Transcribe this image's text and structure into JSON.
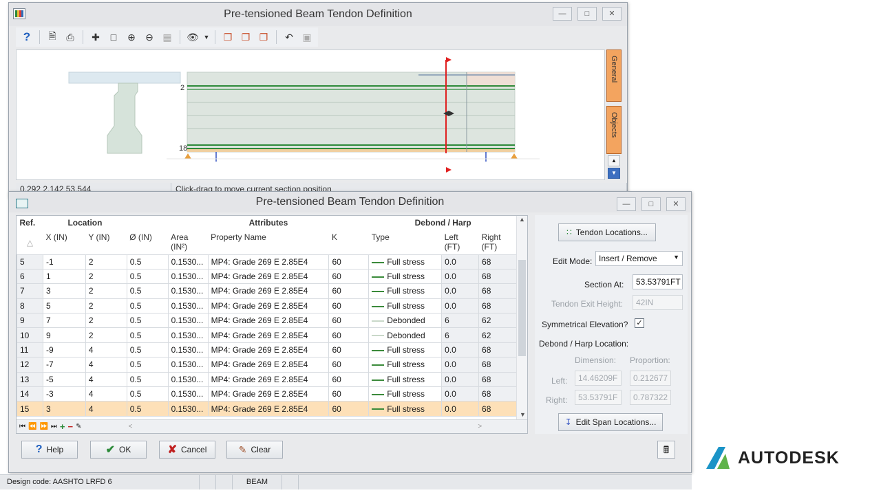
{
  "top_window": {
    "title": "Pre-tensioned Beam Tendon Definition",
    "canvas": {
      "top_label": "2",
      "bottom_label": "18"
    },
    "side_tabs": [
      "General",
      "Objects"
    ],
    "status": {
      "coords": "0.292  2.142  53.544",
      "hint": "Click-drag to move current section position"
    }
  },
  "dialog": {
    "title": "Pre-tensioned Beam Tendon Definition",
    "group_headers": {
      "ref": "Ref.",
      "location": "Location",
      "attributes": "Attributes",
      "debond": "Debond / Harp"
    },
    "columns": [
      "",
      "X (IN)",
      "Y (IN)",
      "Ø (IN)",
      "Area (IN²)",
      "Property Name",
      "K",
      "Type",
      "Left (FT)",
      "Right (FT)"
    ],
    "rows": [
      [
        "5",
        "-1",
        "2",
        "0.5",
        "0.1530...",
        "MP4: Grade 269 E 2.85E4",
        "60",
        "Full stress",
        "0.0",
        "68"
      ],
      [
        "6",
        "1",
        "2",
        "0.5",
        "0.1530...",
        "MP4: Grade 269 E 2.85E4",
        "60",
        "Full stress",
        "0.0",
        "68"
      ],
      [
        "7",
        "3",
        "2",
        "0.5",
        "0.1530...",
        "MP4: Grade 269 E 2.85E4",
        "60",
        "Full stress",
        "0.0",
        "68"
      ],
      [
        "8",
        "5",
        "2",
        "0.5",
        "0.1530...",
        "MP4: Grade 269 E 2.85E4",
        "60",
        "Full stress",
        "0.0",
        "68"
      ],
      [
        "9",
        "7",
        "2",
        "0.5",
        "0.1530...",
        "MP4: Grade 269 E 2.85E4",
        "60",
        "Debonded",
        "6",
        "62"
      ],
      [
        "10",
        "9",
        "2",
        "0.5",
        "0.1530...",
        "MP4: Grade 269 E 2.85E4",
        "60",
        "Debonded",
        "6",
        "62"
      ],
      [
        "11",
        "-9",
        "4",
        "0.5",
        "0.1530...",
        "MP4: Grade 269 E 2.85E4",
        "60",
        "Full stress",
        "0.0",
        "68"
      ],
      [
        "12",
        "-7",
        "4",
        "0.5",
        "0.1530...",
        "MP4: Grade 269 E 2.85E4",
        "60",
        "Full stress",
        "0.0",
        "68"
      ],
      [
        "13",
        "-5",
        "4",
        "0.5",
        "0.1530...",
        "MP4: Grade 269 E 2.85E4",
        "60",
        "Full stress",
        "0.0",
        "68"
      ],
      [
        "14",
        "-3",
        "4",
        "0.5",
        "0.1530...",
        "MP4: Grade 269 E 2.85E4",
        "60",
        "Full stress",
        "0.0",
        "68"
      ],
      [
        "15",
        "3",
        "4",
        "0.5",
        "0.1530...",
        "MP4: Grade 269 E 2.85E4",
        "60",
        "Full stress",
        "0.0",
        "68"
      ]
    ],
    "selected_row": "15",
    "right_panel": {
      "tendon_locations_btn": "Tendon Locations...",
      "edit_mode_label": "Edit Mode:",
      "edit_mode_value": "Insert / Remove",
      "section_at_label": "Section At:",
      "section_at_value": "53.53791FT",
      "tendon_exit_label": "Tendon Exit Height:",
      "tendon_exit_value": "42IN",
      "sym_elev_label": "Symmetrical Elevation?",
      "sym_elev_checked": true,
      "debond_group": "Debond / Harp Location:",
      "dimension_hdr": "Dimension:",
      "proportion_hdr": "Proportion:",
      "left_label": "Left:",
      "right_label": "Right:",
      "left_dim": "14.46209F",
      "left_prop": "0.212677",
      "right_dim": "53.53791F",
      "right_prop": "0.787322",
      "edit_span_btn": "Edit Span Locations..."
    },
    "buttons": {
      "help": "Help",
      "ok": "OK",
      "cancel": "Cancel",
      "clear": "Clear"
    }
  },
  "statusbar": {
    "design_code": "Design code: AASHTO LRFD 6",
    "mode": "BEAM"
  },
  "brand": "AUTODESK"
}
